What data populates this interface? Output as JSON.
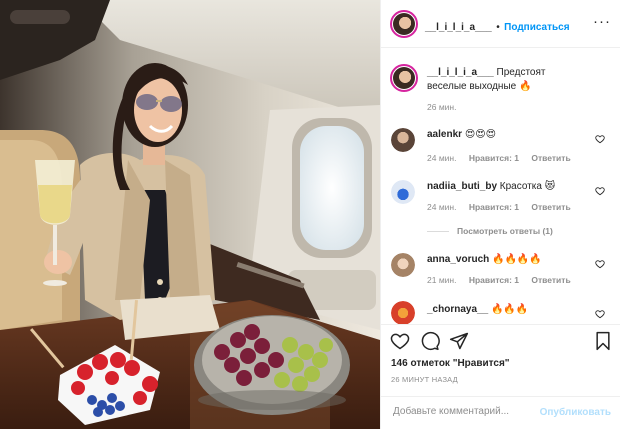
{
  "post": {
    "author": "__l_i_l_i_a___",
    "dot": "•",
    "follow_label": "Подписаться",
    "more_label": "···",
    "caption_text": "Предстоят веселые выходные 🔥",
    "caption_time": "26 мин."
  },
  "comments": [
    {
      "user": "aalenkr",
      "text": "😍😍😍",
      "time": "24 мин.",
      "likes": "Нравится: 1",
      "reply": "Ответить"
    },
    {
      "user": "nadiia_buti_by",
      "text": "Красотка 😻",
      "time": "24 мин.",
      "likes": "Нравится: 1",
      "reply": "Ответить"
    },
    {
      "user": "anna_voruch",
      "text": "🔥🔥🔥🔥",
      "time": "21 мин.",
      "likes": "Нравится: 1",
      "reply": "Ответить"
    },
    {
      "user": "_chornaya__",
      "text": "🔥🔥🔥",
      "time": "",
      "likes": "",
      "reply": ""
    }
  ],
  "view_replies_label": "Посмотреть ответы (1)",
  "likes_text": "146 отметок \"Нравится\"",
  "time_ago": "26 МИНУТ НАЗАД",
  "comment_input": {
    "placeholder": "Добавьте комментарий...",
    "value": ""
  },
  "publish_label": "Опубликовать",
  "colors": {
    "accent": "#0095f6",
    "publish_disabled": "#b2dffc",
    "muted": "#8e8e8e",
    "text": "#262626"
  }
}
